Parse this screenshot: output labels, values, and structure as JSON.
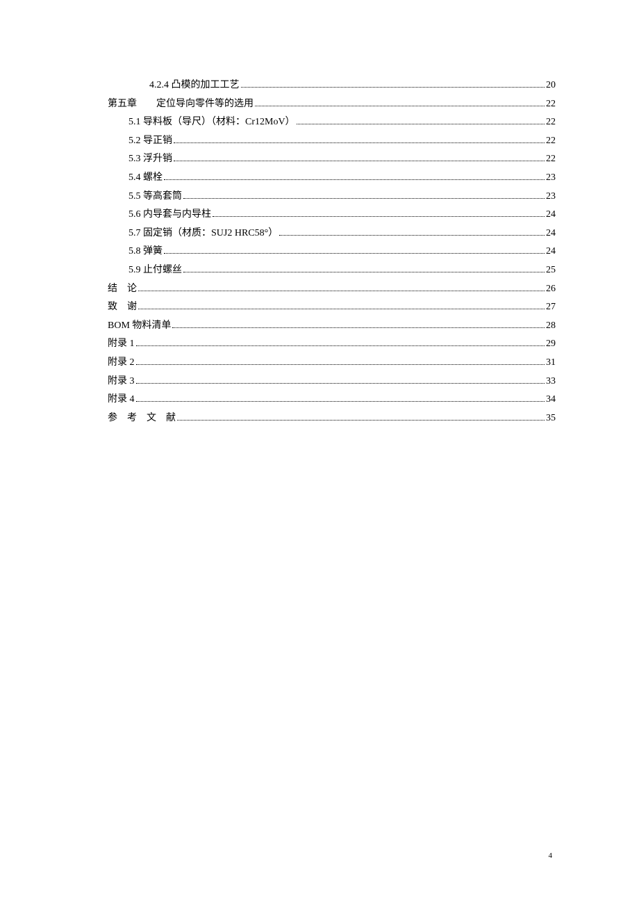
{
  "entries": [
    {
      "indent": 2,
      "label": "4.2.4 凸模的加工工艺",
      "page": "20"
    },
    {
      "indent": 0,
      "label": "第五章　　定位导向零件等的选用",
      "page": "22"
    },
    {
      "indent": 1,
      "label": "5.1 导料板（导尺）（材料：Cr12MoV）",
      "page": "22"
    },
    {
      "indent": 1,
      "label": "5.2 导正销",
      "page": "22"
    },
    {
      "indent": 1,
      "label": "5.3 浮升销",
      "page": "22"
    },
    {
      "indent": 1,
      "label": "5.4 螺栓",
      "page": "23"
    },
    {
      "indent": 1,
      "label": "5.5 等高套筒",
      "page": "23"
    },
    {
      "indent": 1,
      "label": "5.6 内导套与内导柱",
      "page": "24"
    },
    {
      "indent": 1,
      "label": "5.7 固定销（材质：SUJ2 HRC58°）",
      "page": "24"
    },
    {
      "indent": 1,
      "label": "5.8 弹簧",
      "page": "24"
    },
    {
      "indent": 1,
      "label": "5.9 止付螺丝",
      "page": "25"
    },
    {
      "indent": 0,
      "label": "结　论",
      "page": "26"
    },
    {
      "indent": 0,
      "label": "致　谢",
      "page": "27"
    },
    {
      "indent": 0,
      "label": "BOM 物料清单",
      "page": "28"
    },
    {
      "indent": 0,
      "label": "附录 1",
      "page": "29"
    },
    {
      "indent": 0,
      "label": "附录 2",
      "page": "31"
    },
    {
      "indent": 0,
      "label": "附录 3",
      "page": "33"
    },
    {
      "indent": 0,
      "label": "附录 4",
      "page": "34"
    },
    {
      "indent": 0,
      "label": "参　考　文　献",
      "page": "35"
    }
  ],
  "footer_page": "4"
}
